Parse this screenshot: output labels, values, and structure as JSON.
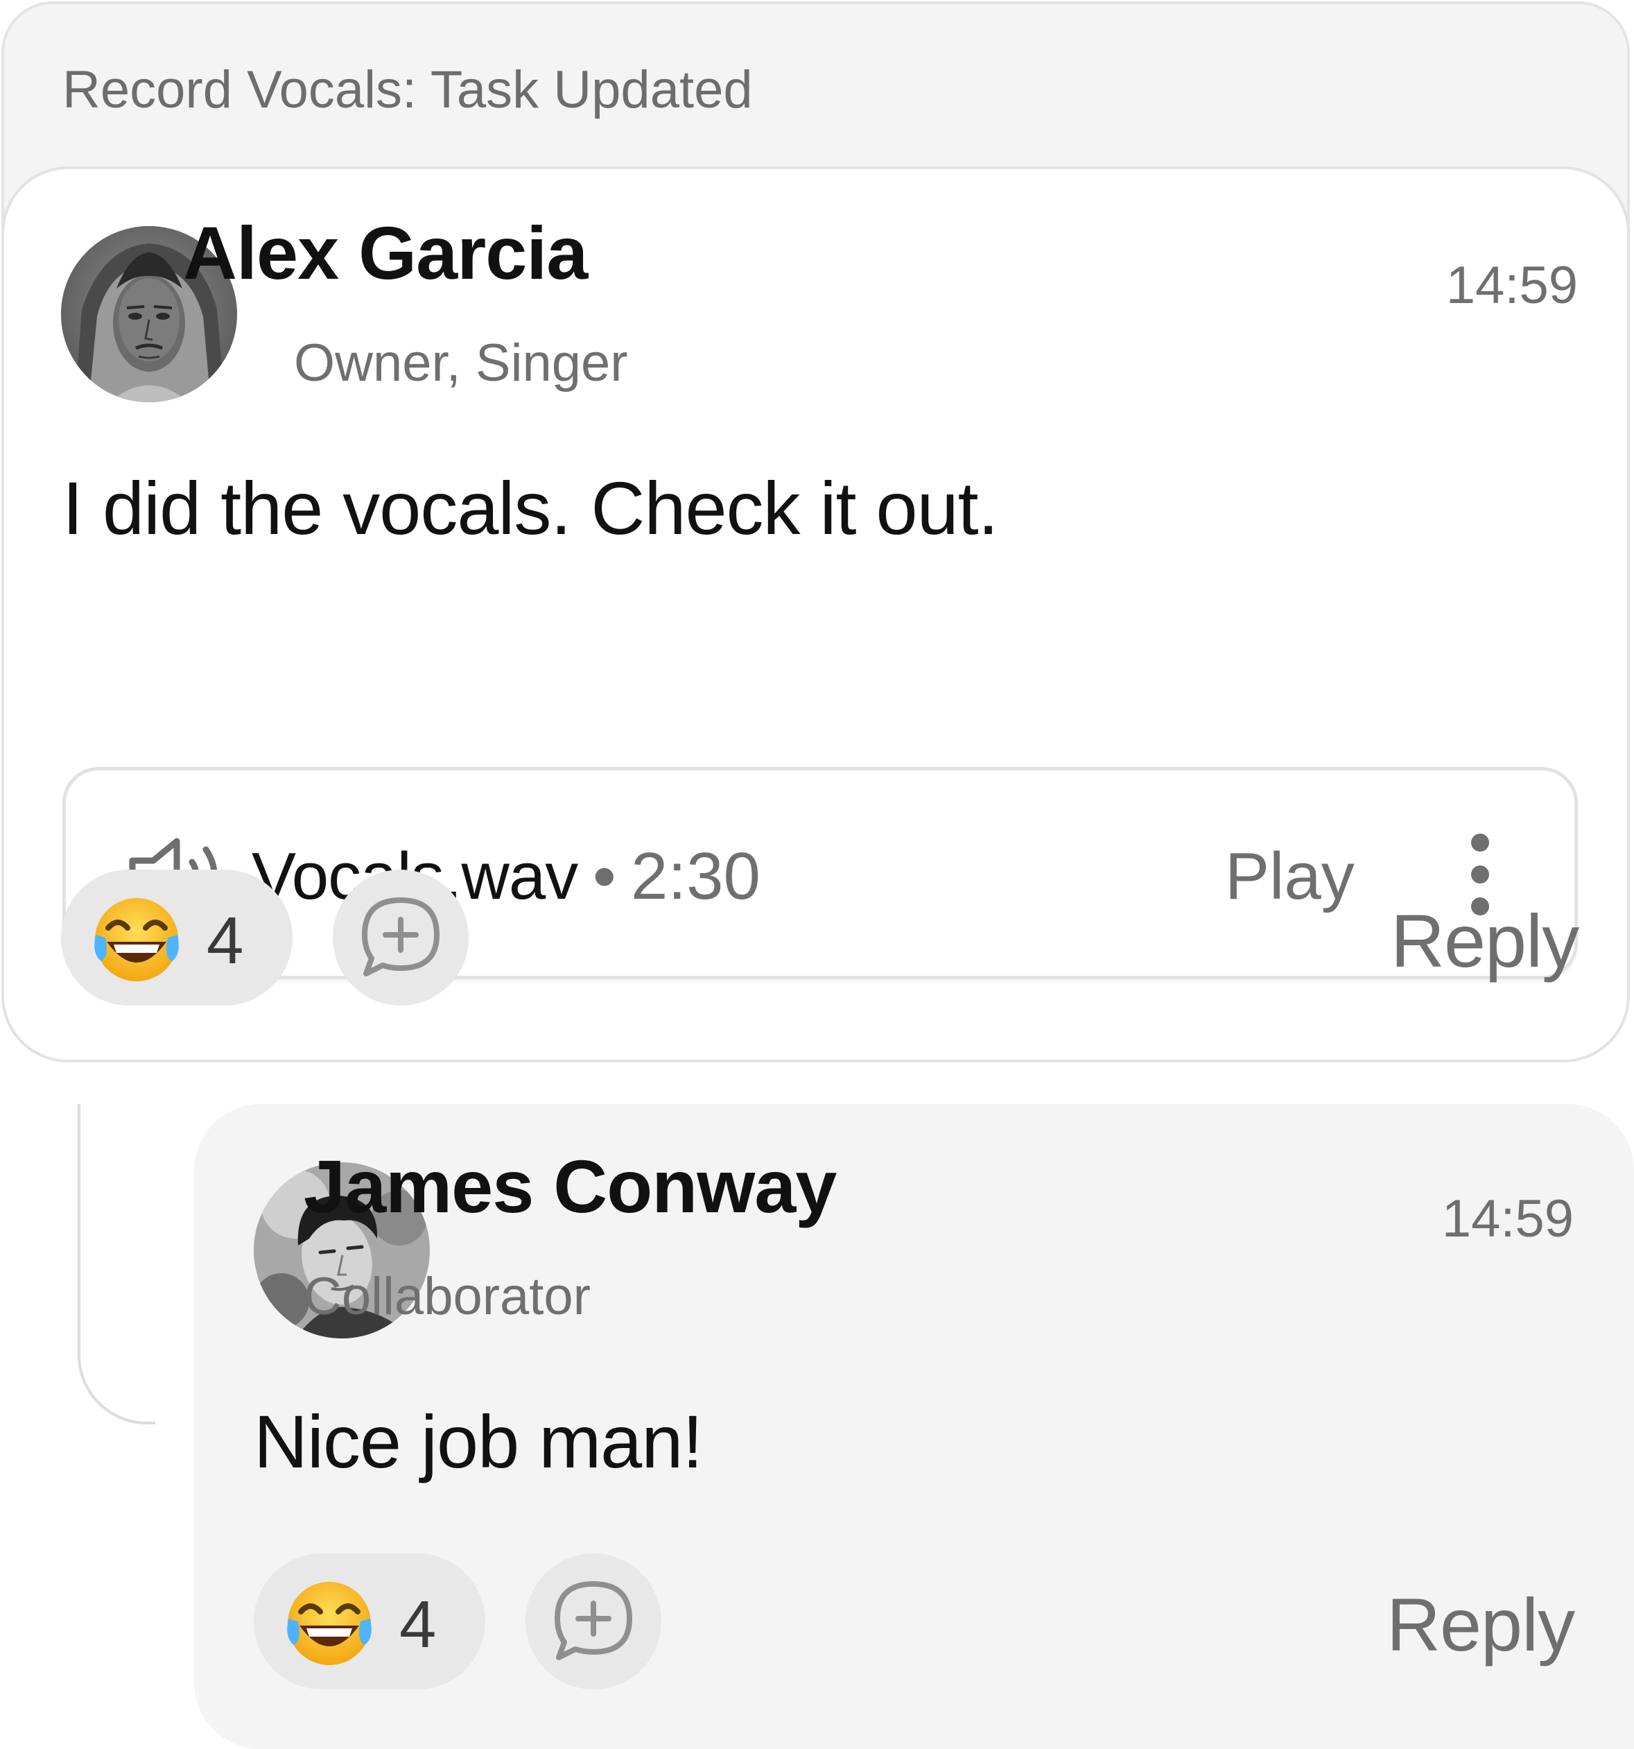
{
  "header": {
    "title": "Record Vocals: Task Updated"
  },
  "message": {
    "author": "Alex Garcia",
    "role": "Owner, Singer",
    "time": "14:59",
    "text": "I did the vocals. Check it out.",
    "attachment": {
      "icon": "speaker-icon",
      "file_name": "Vocals.wav",
      "separator": "•",
      "duration": "2:30",
      "play_label": "Play",
      "more_icon": "more-vertical-icon"
    },
    "reaction": {
      "emoji": "😂",
      "emoji_name": "face-with-tears-of-joy",
      "count": "4"
    },
    "add_reaction_icon": "add-reaction-icon",
    "reply_label": "Reply"
  },
  "reply": {
    "author": "James Conway",
    "role": "Collaborator",
    "time": "14:59",
    "text": "Nice job man!",
    "reaction": {
      "emoji": "😂",
      "emoji_name": "face-with-tears-of-joy",
      "count": "4"
    },
    "add_reaction_icon": "add-reaction-icon",
    "reply_label": "Reply"
  },
  "colors": {
    "card_bg": "#ffffff",
    "header_bg": "#f4f4f4",
    "reply_bg": "#f4f4f4",
    "pill_bg": "#e8e8e8",
    "text_primary": "#111111",
    "text_secondary": "#6f6f6f",
    "border": "#e2e2e2"
  }
}
